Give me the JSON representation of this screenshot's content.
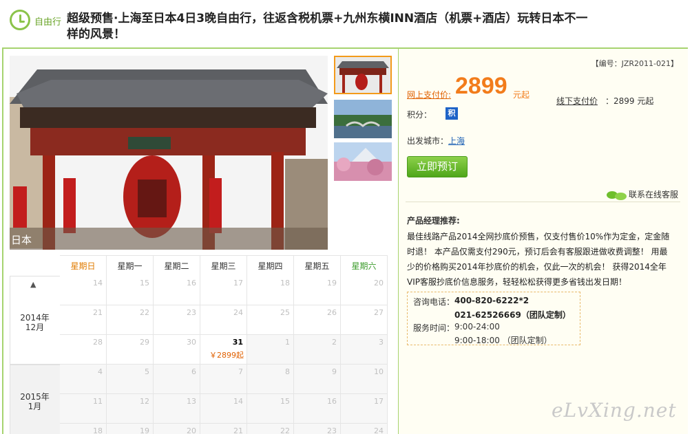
{
  "header": {
    "badge_label": "自由行",
    "title": "超级预售·上海至日本4日3晚自由行，往返含税机票+九州东横INN酒店（机票+酒店）玩转日本不一样的风景！"
  },
  "gallery": {
    "caption": "日本",
    "thumbs": [
      "kaminarimon-gate",
      "imperial-palace-bridge",
      "mount-fuji-blossoms"
    ]
  },
  "calendar": {
    "weekdays": [
      "星期日",
      "星期一",
      "星期二",
      "星期三",
      "星期四",
      "星期五",
      "星期六"
    ],
    "months": [
      {
        "label_year": "2014年",
        "label_month": "12月",
        "weeks": [
          [
            "14",
            "15",
            "16",
            "17",
            "18",
            "19",
            "20"
          ],
          [
            "21",
            "22",
            "23",
            "24",
            "25",
            "26",
            "27"
          ],
          [
            "28",
            "29",
            "30",
            "31",
            "1",
            "2",
            "3"
          ]
        ]
      },
      {
        "label_year": "2015年",
        "label_month": "1月",
        "weeks": [
          [
            "4",
            "5",
            "6",
            "7",
            "8",
            "9",
            "10"
          ],
          [
            "11",
            "12",
            "13",
            "14",
            "15",
            "16",
            "17"
          ],
          [
            "18",
            "19",
            "20",
            "21",
            "22",
            "23",
            "24"
          ]
        ]
      }
    ],
    "active_price": "￥2899起"
  },
  "product": {
    "code": "【编号：JZR2011-021】",
    "online_label": "网上支付价:",
    "online_price": "2899",
    "online_unit": "元起",
    "offline_label": "线下支付价",
    "offline_price": "：2899 元起",
    "points_label": "积分：",
    "points_icon": "积",
    "city_label": "出发城市：",
    "city": "上海",
    "book_label": "立即预订",
    "chat_label": "联系在线客服"
  },
  "recommend": {
    "title": "产品经理推荐:",
    "body": "最佳线路产品2014全网抄底价预售，仅支付售价10%作为定金，定金随时退！ 本产品仅需支付290元，预订后会有客服跟进做收费调整！ 用最少的价格购买2014年抄底价的机会，仅此一次的机会！ 获得2014全年VIP客服抄底价信息服务，轻轻松松获得更多省钱出发日期！"
  },
  "contact": {
    "phone_label": "咨询电话：",
    "phone1": "400-820-6222*2",
    "phone2": "021-62526669（团队定制）",
    "hours_label": "服务时间：",
    "hours1": "9:00-24:00",
    "hours2": "9:00-18:00 （团队定制）"
  },
  "watermark": "eLvXing.net"
}
